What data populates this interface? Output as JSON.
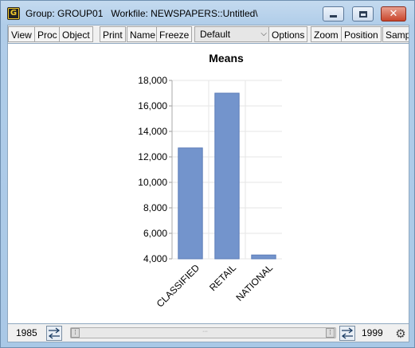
{
  "window": {
    "icon_letter": "G",
    "title": "Group: GROUP01   Workfile: NEWSPAPERS::Untitled\\"
  },
  "toolbar": {
    "buttons": [
      "View",
      "Proc",
      "Object",
      "Print",
      "Name",
      "Freeze",
      "Options",
      "Zoom",
      "Position",
      "Sampl"
    ],
    "select_value": "Default"
  },
  "statusbar": {
    "start_year": "1985",
    "end_year": "1999"
  },
  "colors": {
    "bar_fill": "#7394cc",
    "bar_stroke": "#5b7cb8",
    "grid": "#e6e6e6"
  },
  "icons": {
    "gear": "gear-icon",
    "swap": "swap-arrows-icon"
  },
  "chart_data": {
    "type": "bar",
    "title": "Means",
    "categories": [
      "CLASSIFIED",
      "RETAIL",
      "NATIONAL"
    ],
    "values": [
      12700,
      17000,
      4300
    ],
    "ylim": [
      4000,
      18000
    ],
    "yticks": [
      4000,
      6000,
      8000,
      10000,
      12000,
      14000,
      16000,
      18000
    ],
    "ytick_labels": [
      "4,000",
      "6,000",
      "8,000",
      "10,000",
      "12,000",
      "14,000",
      "16,000",
      "18,000"
    ],
    "grid": true,
    "xlabel": "",
    "ylabel": ""
  }
}
